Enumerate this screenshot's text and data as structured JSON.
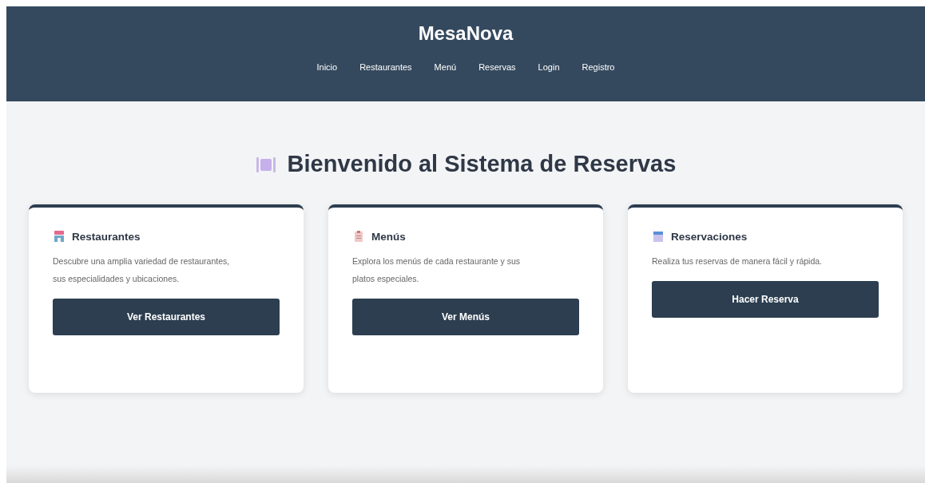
{
  "header": {
    "brand": "MesaNova",
    "nav": [
      {
        "label": "Inicio"
      },
      {
        "label": "Restaurantes"
      },
      {
        "label": "Menú"
      },
      {
        "label": "Reservas"
      },
      {
        "label": "Login"
      },
      {
        "label": "Registro"
      }
    ]
  },
  "hero": {
    "title": "Bienvenido al Sistema de Reservas"
  },
  "cards": [
    {
      "title": "Restaurantes",
      "text": "Descubre una amplia variedad de restaurantes, sus especialidades y ubicaciones.",
      "button": "Ver Restaurantes"
    },
    {
      "title": "Menús",
      "text": "Explora los menús de cada restaurante y sus platos especiales.",
      "button": "Ver Menús"
    },
    {
      "title": "Reservaciones",
      "text": "Realiza tus reservas de manera fácil y rápida.",
      "button": "Hacer Reserva"
    }
  ]
}
